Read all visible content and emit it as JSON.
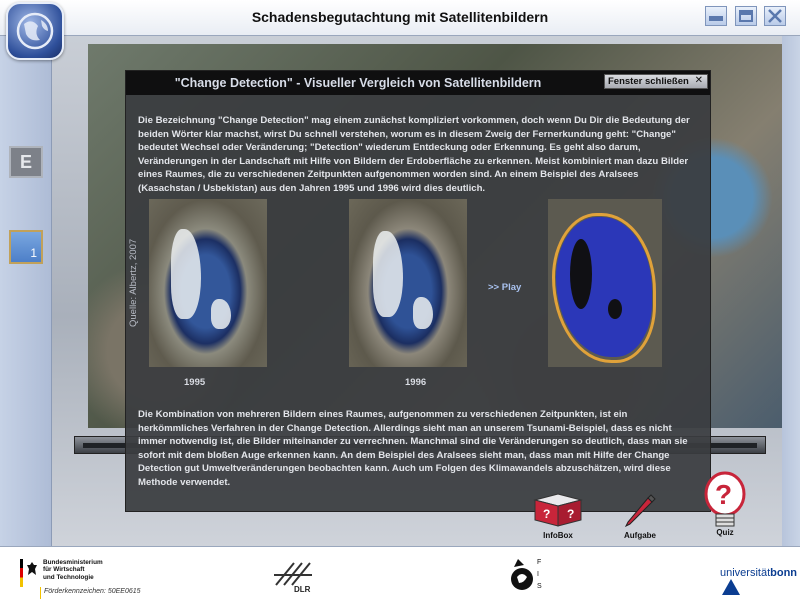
{
  "header": {
    "title": "Schadensbegutachtung mit Satellitenbildern",
    "logo_icon": "globe-icon"
  },
  "window_controls": [
    "minimize-icon",
    "maximize-icon",
    "close-icon"
  ],
  "sidebar": {
    "language_button": "E",
    "page_indicator": "1"
  },
  "dialog": {
    "title": "\"Change Detection\" - Visueller Vergleich von Satellitenbildern",
    "close_label": "Fenster schließen",
    "close_x": "✕",
    "paragraph1": "Die Bezeichnung \"Change Detection\" mag einem zunächst kompliziert vorkommen, doch wenn Du Dir die Bedeutung der beiden Wörter klar machst, wirst Du schnell verstehen, worum es in diesem Zweig der Fernerkundung geht: \"Change\" bedeutet Wechsel oder Veränderung; \"Detection\" wiederum Entdeckung oder Erkennung. Es geht also darum, Veränderungen in der Landschaft mit Hilfe von Bildern der Erdoberfläche zu erkennen. Meist kombiniert man dazu Bilder eines Raumes, die zu verschiedenen Zeitpunkten aufgenommen worden sind. An einem Beispiel des Aralsees (Kasachstan / Usbekistan) aus den Jahren 1995 und 1996 wird dies deutlich.",
    "image_credit": "Quelle: Albertz, 2007",
    "year1": "1995",
    "year2": "1996",
    "play_link": ">> Play",
    "paragraph2": "Die Kombination von mehreren Bildern eines Raumes, aufgenommen zu verschiedenen Zeitpunkten, ist ein herkömmliches Verfahren in der Change Detection. Allerdings sieht man an unserem Tsunami-Beispiel, dass es nicht immer notwendig ist, die Bilder miteinander zu verrechnen. Manchmal sind die Veränderungen so deutlich, dass man sie sofort mit dem bloßen Auge erkennen kann. An dem Beispiel des Aralsees sieht man, dass man mit Hilfe der Change Detection gut Umweltveränderungen beobachten kann. Auch um Folgen des Klimawandels abzuschätzen, wird diese Methode verwendet."
  },
  "tools": {
    "infobox": "InfoBox",
    "aufgabe": "Aufgabe",
    "quiz": "Quiz"
  },
  "footer": {
    "bmwi_lines": [
      "Bundesministerium",
      "für Wirtschaft",
      "und Technologie"
    ],
    "foerder": "Förderkennzeichen: 50EE0615",
    "dlr": "DLR",
    "fis_letters": [
      "F",
      "I",
      "S"
    ],
    "uni_prefix": "universität",
    "uni_name": "bonn"
  },
  "colors": {
    "dialog_bg": "#3a3c40",
    "title_text": "#d8dde8",
    "link": "#a9c2ef",
    "lake_change": "#e0a23a",
    "lake_blue": "#2b37b8"
  }
}
